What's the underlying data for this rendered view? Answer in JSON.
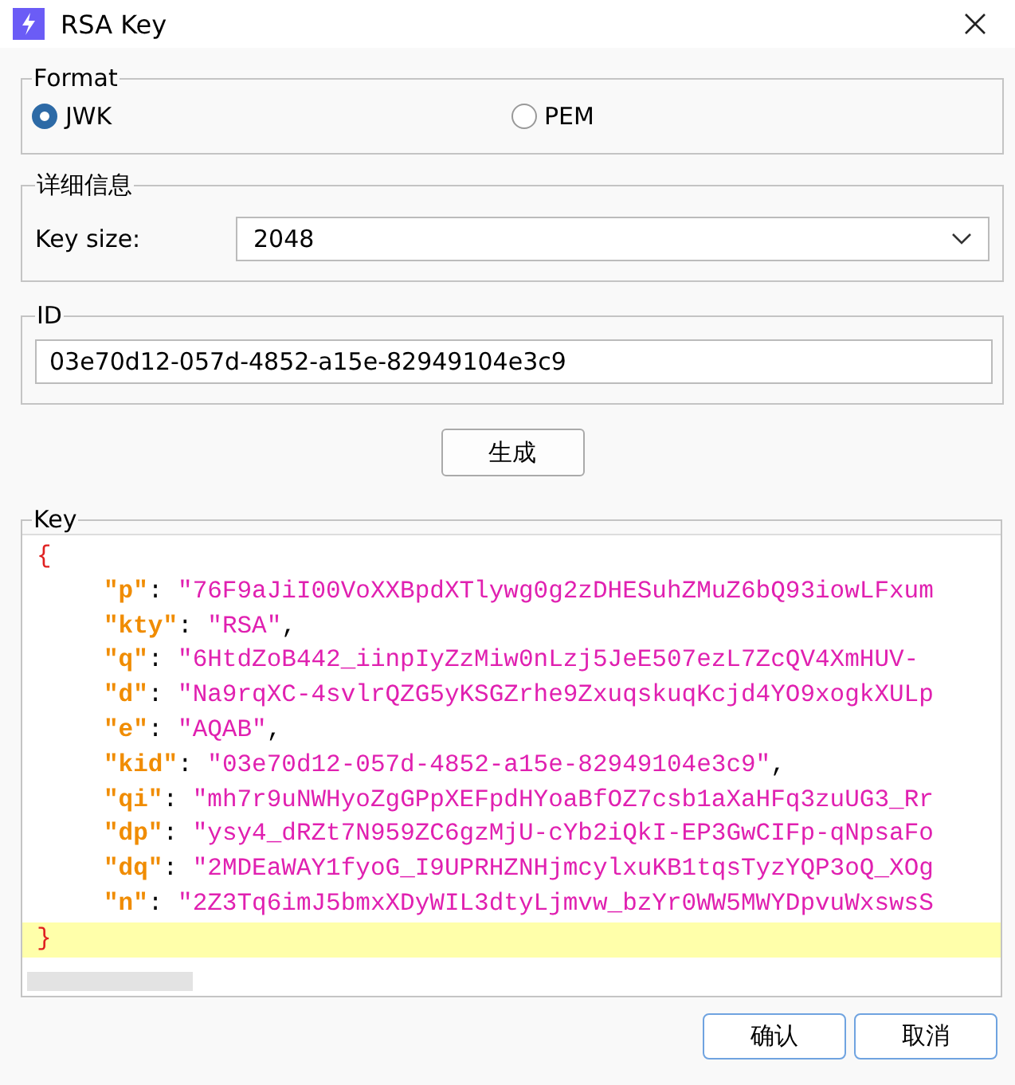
{
  "window": {
    "title": "RSA Key"
  },
  "format": {
    "legend": "Format",
    "options": [
      {
        "label": "JWK",
        "selected": true
      },
      {
        "label": "PEM",
        "selected": false
      }
    ]
  },
  "details": {
    "legend": "详细信息",
    "key_size": {
      "label": "Key size:",
      "value": "2048"
    }
  },
  "id": {
    "legend": "ID",
    "value": "03e70d12-057d-4852-a15e-82949104e3c9"
  },
  "generate_button": "生成",
  "key": {
    "legend": "Key",
    "open": "{",
    "close": "}",
    "close_highlighted": true,
    "lines": [
      {
        "key": "\"p\"",
        "colon": ":",
        "value": "\"76F9aJiI00VoXXBpdXTlywg0g2zDHESuhZMuZ6bQ93iowLFxum"
      },
      {
        "key": "\"kty\"",
        "colon": ":",
        "value": "\"RSA\"",
        "comma": ","
      },
      {
        "key": "\"q\"",
        "colon": ":",
        "value": "\"6HtdZoB442_iinpIyZzMiw0nLzj5JeE507ezL7ZcQV4XmHUV-"
      },
      {
        "key": "\"d\"",
        "colon": ":",
        "value": "\"Na9rqXC-4svlrQZG5yKSGZrhe9ZxuqskuqKcjd4YO9xogkXULp"
      },
      {
        "key": "\"e\"",
        "colon": ":",
        "value": "\"AQAB\"",
        "comma": ","
      },
      {
        "key": "\"kid\"",
        "colon": ":",
        "value": "\"03e70d12-057d-4852-a15e-82949104e3c9\"",
        "comma": ","
      },
      {
        "key": "\"qi\"",
        "colon": ":",
        "value": "\"mh7r9uNWHyoZgGPpXEFpdHYoaBfOZ7csb1aXaHFq3zuUG3_Rr"
      },
      {
        "key": "\"dp\"",
        "colon": ":",
        "value": "\"ysy4_dRZt7N959ZC6gzMjU-cYb2iQkI-EP3GwCIFp-qNpsaFo"
      },
      {
        "key": "\"dq\"",
        "colon": ":",
        "value": "\"2MDEaWAY1fyoG_I9UPRHZNHjmcylxuKB1tqsTyzYQP3oQ_XOg"
      },
      {
        "key": "\"n\"",
        "colon": ":",
        "value": "\"2Z3Tq6imJ5bmxXDyWIL3dtyLjmvw_bzYr0WW5MWYDpvuWxswsS"
      }
    ]
  },
  "buttons": [
    {
      "label": "确认"
    },
    {
      "label": "取消"
    }
  ]
}
